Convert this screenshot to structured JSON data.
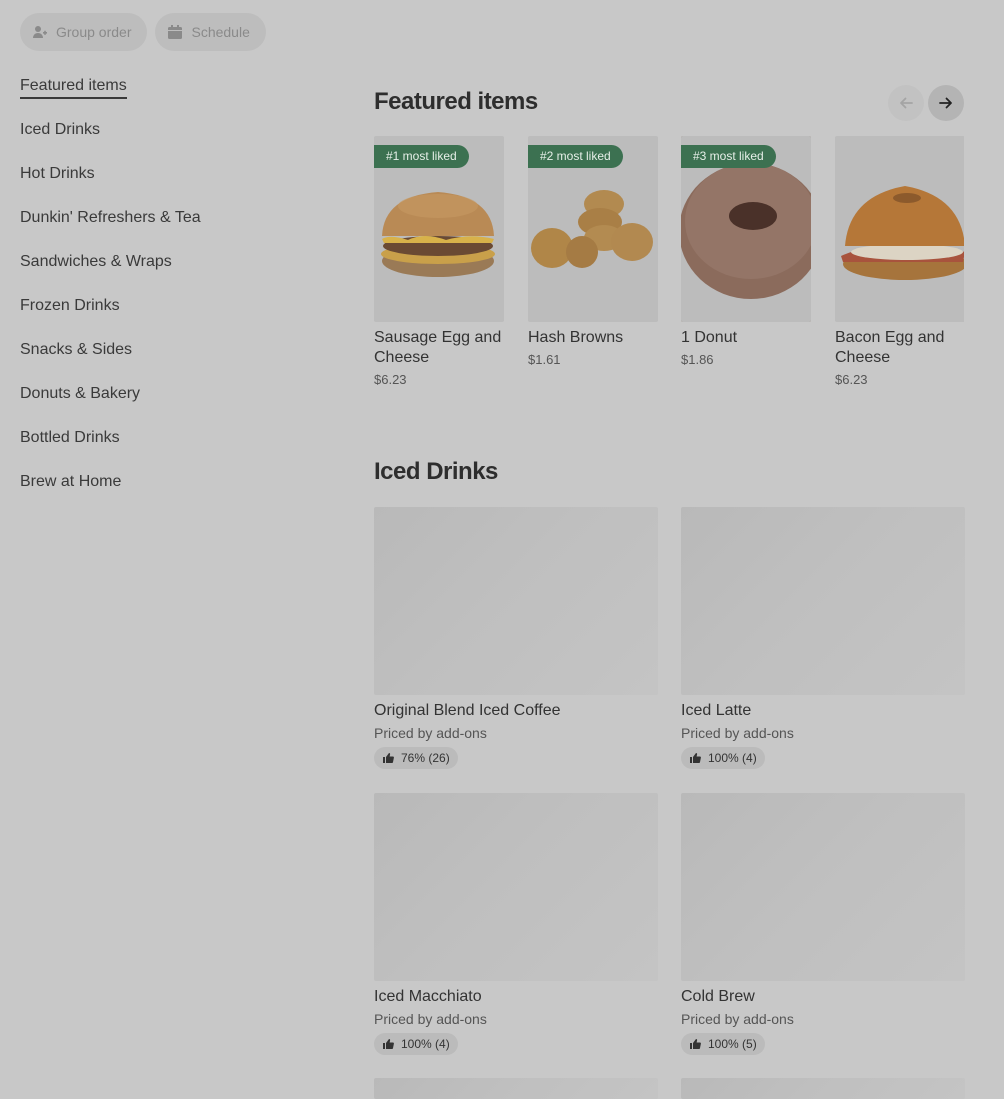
{
  "top_actions": {
    "group_order": "Group order",
    "schedule": "Schedule"
  },
  "sidebar": {
    "items": [
      {
        "label": "Featured items",
        "active": true
      },
      {
        "label": "Iced Drinks"
      },
      {
        "label": "Hot Drinks"
      },
      {
        "label": "Dunkin' Refreshers & Tea"
      },
      {
        "label": "Sandwiches & Wraps"
      },
      {
        "label": "Frozen Drinks"
      },
      {
        "label": "Snacks & Sides"
      },
      {
        "label": "Donuts & Bakery"
      },
      {
        "label": "Bottled Drinks"
      },
      {
        "label": "Brew at Home"
      }
    ]
  },
  "featured": {
    "title": "Featured items",
    "items": [
      {
        "badge": "#1 most liked",
        "name": "Sausage Egg and Cheese",
        "price": "$6.23",
        "image": "sandwich"
      },
      {
        "badge": "#2 most liked",
        "name": "Hash Browns",
        "price": "$1.61",
        "image": "hash-browns"
      },
      {
        "badge": "#3 most liked",
        "name": "1 Donut",
        "price": "$1.86",
        "image": "donut"
      },
      {
        "badge": "",
        "name": "Bacon Egg and Cheese",
        "price": "$6.23",
        "image": "bagel"
      }
    ]
  },
  "iced_drinks": {
    "title": "Iced Drinks",
    "items": [
      {
        "name": "Original Blend Iced Coffee",
        "subtitle": "Priced by add-ons",
        "rating": "76% (26)"
      },
      {
        "name": "Iced Latte",
        "subtitle": "Priced by add-ons",
        "rating": "100% (4)"
      },
      {
        "name": "Iced Macchiato",
        "subtitle": "Priced by add-ons",
        "rating": "100% (4)"
      },
      {
        "name": "Cold Brew",
        "subtitle": "Priced by add-ons",
        "rating": "100% (5)"
      }
    ]
  },
  "icons": {
    "group_order": "user-add-icon",
    "schedule": "calendar-icon",
    "prev": "arrow-left-icon",
    "next": "arrow-right-icon",
    "rating": "thumbs-up-icon"
  },
  "colors": {
    "badge": "#3c7151",
    "overlay": "#c8c8c8"
  }
}
